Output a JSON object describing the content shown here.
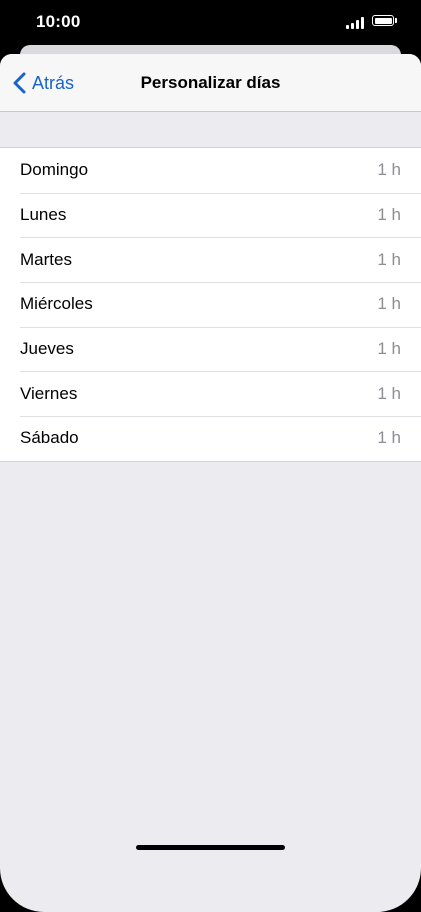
{
  "status_bar": {
    "time": "10:00",
    "signal_icon": "cellular-signal-icon",
    "battery_icon": "battery-icon"
  },
  "navbar": {
    "back_label": "Atrás",
    "back_icon": "chevron-left-icon",
    "title": "Personalizar días"
  },
  "days": [
    {
      "label": "Domingo",
      "value": "1 h"
    },
    {
      "label": "Lunes",
      "value": "1 h"
    },
    {
      "label": "Martes",
      "value": "1 h"
    },
    {
      "label": "Miércoles",
      "value": "1 h"
    },
    {
      "label": "Jueves",
      "value": "1 h"
    },
    {
      "label": "Viernes",
      "value": "1 h"
    },
    {
      "label": "Sábado",
      "value": "1 h"
    }
  ],
  "colors": {
    "accent": "#1a63c9",
    "background": "#ebebf0",
    "secondary_text": "#8e8e93"
  }
}
